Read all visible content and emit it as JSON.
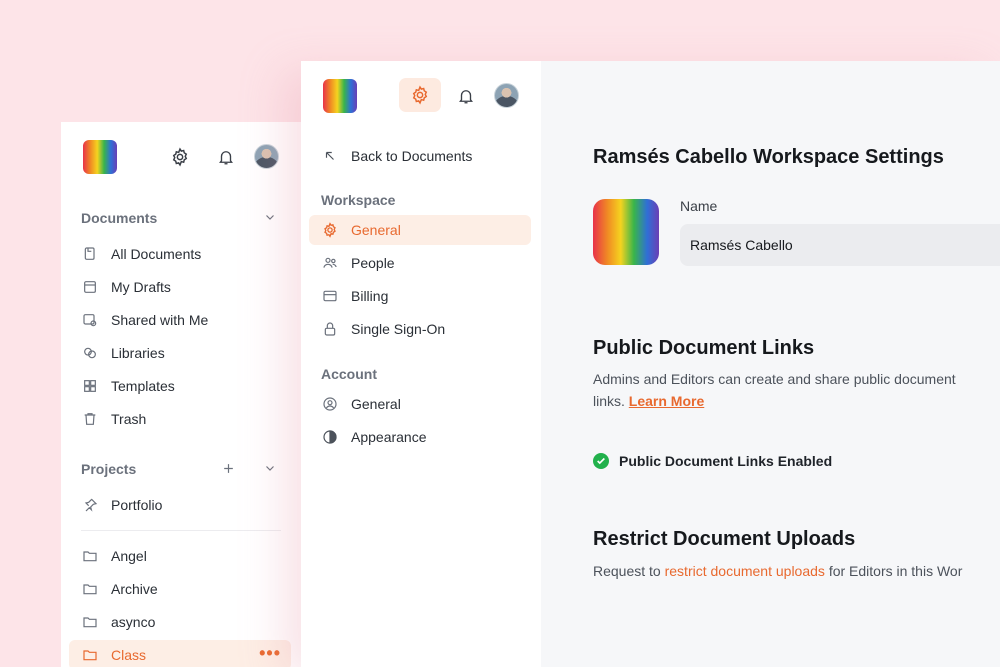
{
  "back_window": {
    "header": {
      "logo": "rainbow-logo",
      "icons": [
        "gear-icon",
        "bell-icon",
        "avatar"
      ]
    },
    "documents": {
      "title": "Documents",
      "items": [
        {
          "label": "All Documents",
          "icon": "documents-icon"
        },
        {
          "label": "My Drafts",
          "icon": "drafts-icon"
        },
        {
          "label": "Shared with Me",
          "icon": "shared-icon"
        },
        {
          "label": "Libraries",
          "icon": "libraries-icon"
        },
        {
          "label": "Templates",
          "icon": "templates-icon"
        },
        {
          "label": "Trash",
          "icon": "trash-icon"
        }
      ]
    },
    "projects": {
      "title": "Projects",
      "items": [
        {
          "label": "Portfolio",
          "icon": "pin-icon"
        },
        {
          "label": "Angel",
          "icon": "folder-icon"
        },
        {
          "label": "Archive",
          "icon": "folder-icon"
        },
        {
          "label": "asynco",
          "icon": "folder-icon"
        },
        {
          "label": "Class",
          "icon": "folder-icon",
          "active": true
        }
      ],
      "more_label": "•••"
    }
  },
  "front_window": {
    "sidebar": {
      "back_label": "Back to Documents",
      "workspace_title": "Workspace",
      "workspace_items": [
        {
          "label": "General",
          "icon": "gear-icon",
          "active": true
        },
        {
          "label": "People",
          "icon": "people-icon"
        },
        {
          "label": "Billing",
          "icon": "card-icon"
        },
        {
          "label": "Single Sign-On",
          "icon": "lock-icon"
        }
      ],
      "account_title": "Account",
      "account_items": [
        {
          "label": "General",
          "icon": "user-circle-icon"
        },
        {
          "label": "Appearance",
          "icon": "contrast-icon"
        }
      ]
    },
    "main": {
      "title": "Ramsés Cabello Workspace Settings",
      "name_label": "Name",
      "name_value": "Ramsés Cabello",
      "public_links": {
        "title": "Public Document Links",
        "desc_line1": "Admins and Editors can create and share public document",
        "desc_line2": "links.",
        "learn_more": "Learn More",
        "status": "Public Document Links Enabled"
      },
      "uploads": {
        "title": "Restrict Document Uploads",
        "desc_pre": "Request to",
        "desc_link": "restrict document uploads",
        "desc_post": "for Editors in this Wor"
      }
    }
  },
  "colors": {
    "accent": "#e8692f",
    "accent_bg": "#fdeee5",
    "success": "#22b14c",
    "page_bg": "#fde4e8"
  }
}
